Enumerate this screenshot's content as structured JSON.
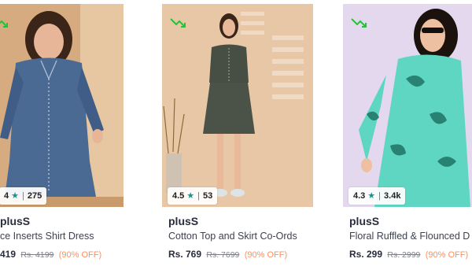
{
  "products": [
    {
      "brand": "plusS",
      "title": "ce Inserts Shirt Dress",
      "price": "419",
      "mrp": "Rs. 4199",
      "discount": "(90% OFF)",
      "rating": "4",
      "rating_count": "275",
      "trend_icon": "trending-down-icon",
      "bg_color": "#d5ab7f"
    },
    {
      "brand": "plusS",
      "title": "Cotton Top and Skirt Co-Ords",
      "price": "Rs. 769",
      "mrp": "Rs. 7699",
      "discount": "(90% OFF)",
      "rating": "4.5",
      "rating_count": "53",
      "trend_icon": "trending-down-icon",
      "bg_color": "#e8c7a6"
    },
    {
      "brand": "plusS",
      "title": "Floral Ruffled & Flounced D",
      "price": "Rs. 299",
      "mrp": "Rs. 2999",
      "discount": "(90% OFF)",
      "rating": "4.3",
      "rating_count": "3.4k",
      "trend_icon": "trending-down-icon",
      "bg_color": "#e3d8ee"
    }
  ],
  "colors": {
    "star": "#14958f",
    "discount": "#ff905a",
    "trend": "#26c235"
  }
}
